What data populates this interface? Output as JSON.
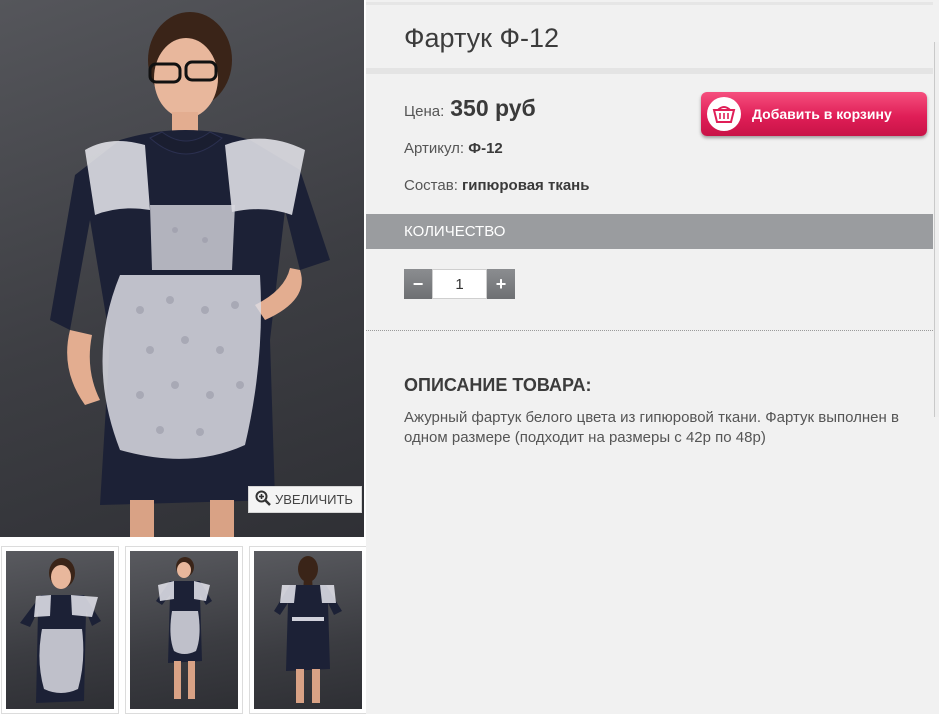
{
  "product": {
    "title": "Фартук Ф-12",
    "price_label": "Цена:",
    "price_value": "350 руб",
    "article_label": "Артикул:",
    "article_value": "Ф-12",
    "composition_label": "Состав:",
    "composition_value": "гипюровая ткань"
  },
  "gallery": {
    "zoom_label": "УВЕЛИЧИТЬ",
    "main_image_alt": "",
    "thumbnails": [
      {
        "name": "thumbnail-front"
      },
      {
        "name": "thumbnail-full"
      },
      {
        "name": "thumbnail-back"
      }
    ]
  },
  "cart": {
    "add_label": "Добавить в корзину",
    "icon": "basket-icon",
    "color": "#e01e57"
  },
  "quantity": {
    "section_label": "КОЛИЧЕСТВО",
    "minus": "−",
    "plus": "+",
    "value": "1"
  },
  "description": {
    "heading": "ОПИСАНИЕ ТОВАРА:",
    "text": "Ажурный фартук белого цвета из гипюровой ткани. Фартук выполнен в одном размере (подходит на размеры с 42р по 48р)"
  }
}
